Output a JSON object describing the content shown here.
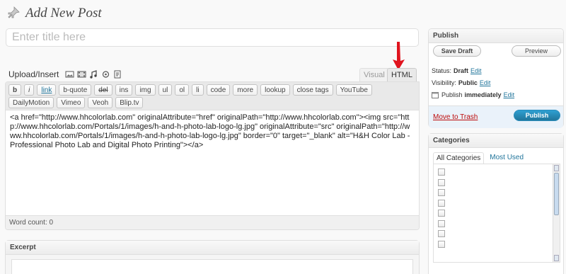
{
  "page": {
    "title": "Add New Post",
    "title_placeholder": "Enter title here"
  },
  "upload": {
    "label": "Upload/Insert",
    "icons": [
      "image-icon",
      "video-icon",
      "audio-icon",
      "media-icon",
      "text-icon"
    ]
  },
  "editor": {
    "tabs": {
      "visual": "Visual",
      "html": "HTML"
    },
    "active_tab": "HTML",
    "quicktags": [
      "b",
      "i",
      "link",
      "b-quote",
      "del",
      "ins",
      "img",
      "ul",
      "ol",
      "li",
      "code",
      "more",
      "lookup",
      "close tags",
      "YouTube",
      "DailyMotion",
      "Vimeo",
      "Veoh",
      "Blip.tv"
    ],
    "content": "<a href=\"http://www.hhcolorlab.com\" originalAttribute=\"href\" originalPath=\"http://www.hhcolorlab.com\"><img src=\"http://www.hhcolorlab.com/Portals/1/images/h-and-h-photo-lab-logo-lg.jpg\" originalAttribute=\"src\" originalPath=\"http://www.hhcolorlab.com/Portals/1/images/h-and-h-photo-lab-logo-lg.jpg\" border=\"0\" target=\"_blank\" alt=\"H&H Color Lab - Professional Photo Lab and Digital Photo Printing\"></a>",
    "word_count": "Word count: 0"
  },
  "excerpt": {
    "title": "Excerpt"
  },
  "publish": {
    "title": "Publish",
    "save_draft": "Save Draft",
    "preview": "Preview",
    "status_label": "Status:",
    "status_value": "Draft",
    "visibility_label": "Visibility:",
    "visibility_value": "Public",
    "publish_label": "Publish",
    "publish_value": "immediately",
    "edit": "Edit",
    "trash": "Move to Trash",
    "publish_button": "Publish"
  },
  "categories": {
    "title": "Categories",
    "tab_all": "All Categories",
    "tab_used": "Most Used",
    "checkbox_count": 8
  },
  "colors": {
    "accent": "#21759b",
    "trash": "#bc0b0b",
    "arrow": "#e0141e"
  }
}
